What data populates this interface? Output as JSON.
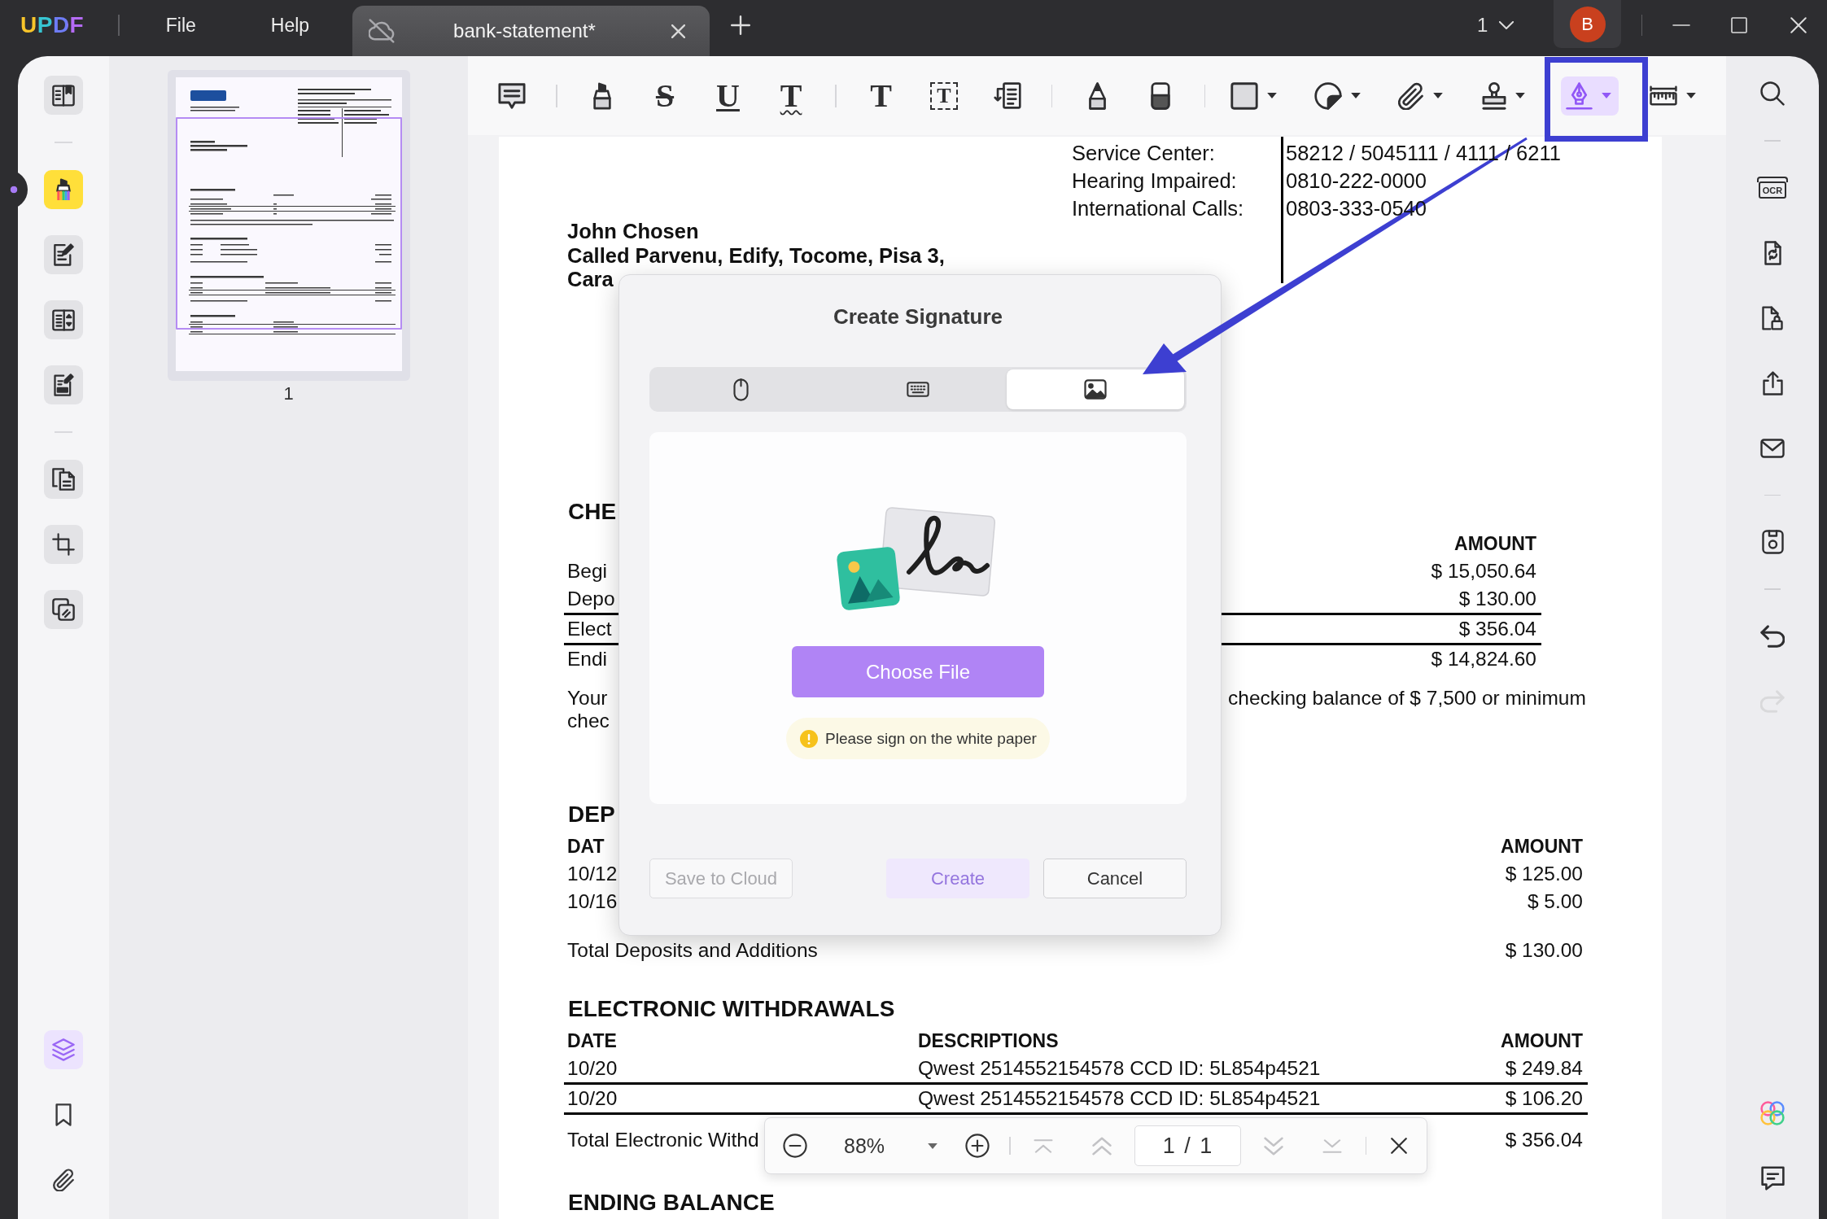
{
  "title_bar": {
    "logo": "UPDF",
    "menus": [
      "File",
      "Help"
    ],
    "tabs": [
      {
        "title": "bank-statement*",
        "selected": true
      }
    ],
    "window_count": "1",
    "avatar": "B"
  },
  "left_rail": {
    "groups": [
      [
        {
          "kind": "book",
          "selected": false
        }
      ],
      [
        {
          "kind": "highlighter",
          "selected": true
        },
        {
          "kind": "page-pen",
          "selected": false
        },
        {
          "kind": "page-list",
          "selected": false
        },
        {
          "kind": "page-sign",
          "selected": false
        }
      ],
      [
        {
          "kind": "pages",
          "selected": false
        },
        {
          "kind": "crop",
          "selected": false
        },
        {
          "kind": "overlap",
          "selected": false
        }
      ]
    ],
    "panels": [
      {
        "kind": "layers",
        "selected": true
      },
      {
        "kind": "bookmark",
        "selected": false
      },
      {
        "kind": "paperclip",
        "selected": false
      }
    ]
  },
  "thumbnails": [
    {
      "label": "1",
      "selected": true
    }
  ],
  "toolbar": {
    "groups": [
      [
        {
          "kind": "note",
          "menu": false,
          "selected": false
        }
      ],
      [
        {
          "kind": "highlight",
          "menu": false,
          "selected": false
        },
        {
          "kind": "strikethrough",
          "glyph": "S",
          "menu": false,
          "selected": false
        },
        {
          "kind": "underline",
          "glyph": "U",
          "menu": false,
          "selected": false
        },
        {
          "kind": "squiggly",
          "glyph": "T",
          "menu": false,
          "selected": false
        }
      ],
      [
        {
          "kind": "text",
          "glyph": "T",
          "menu": false,
          "selected": false
        },
        {
          "kind": "textbox",
          "glyph": "T",
          "menu": false,
          "selected": false
        },
        {
          "kind": "callout",
          "menu": false,
          "selected": false
        }
      ],
      [
        {
          "kind": "pencil",
          "menu": false,
          "selected": false
        },
        {
          "kind": "eraser",
          "menu": false,
          "selected": false
        }
      ],
      [
        {
          "kind": "shape",
          "menu": true,
          "selected": false
        },
        {
          "kind": "sticker",
          "menu": true,
          "selected": false
        },
        {
          "kind": "attachment",
          "menu": true,
          "selected": false
        },
        {
          "kind": "stamp",
          "menu": true,
          "selected": false
        },
        {
          "kind": "signature",
          "menu": true,
          "selected": true
        },
        {
          "kind": "measure",
          "menu": true,
          "selected": false
        }
      ]
    ]
  },
  "document": {
    "contact": [
      {
        "label": "Service Center:",
        "value": "58212 / 5045111 / 4111 / 6211"
      },
      {
        "label": "Hearing Impaired:",
        "value": "0810-222-0000"
      },
      {
        "label": "International Calls:",
        "value": "0803-333-0540"
      }
    ],
    "address": [
      "John Chosen",
      "Called Parvenu, Edify, Tocome, Pisa 3,",
      "Cara"
    ],
    "sections": [
      {
        "kind": "summary",
        "title": "CHE",
        "header": {
          "amount": "AMOUNT"
        },
        "rows": [
          {
            "label": "Begi",
            "amount": "$ 15,050.64",
            "rule_below": false
          },
          {
            "label": "Depo",
            "amount": "$ 130.00",
            "rule_below": true
          },
          {
            "label": "Elect",
            "amount": "$ 356.04",
            "rule_below": true
          },
          {
            "label": "Endi",
            "amount": "$ 14,824.60",
            "rule_below": false
          }
        ],
        "note": [
          {
            "left": "Your",
            "right": "checking balance of $ 7,500 or minimum"
          },
          {
            "left": "chec"
          }
        ]
      },
      {
        "kind": "deposits",
        "title": "DEP",
        "header": {
          "date": "DAT",
          "amount": "AMOUNT"
        },
        "rows": [
          {
            "date": "10/12",
            "amount": "$ 125.00",
            "rule_below": false
          },
          {
            "date": "10/16",
            "amount": "$ 5.00",
            "rule_below": false
          }
        ],
        "total": {
          "label": "Total Deposits and Additions",
          "amount": "$ 130.00"
        }
      },
      {
        "kind": "withdrawals",
        "title": "ELECTRONIC WITHDRAWALS",
        "header": {
          "date": "DATE",
          "description": "DESCRIPTIONS",
          "amount": "AMOUNT"
        },
        "rows": [
          {
            "date": "10/20",
            "description": "Qwest 2514552154578 CCD ID: 5L854p4521",
            "amount": "$ 249.84",
            "rule_below": true
          },
          {
            "date": "10/20",
            "description": "Qwest 2514552154578 CCD ID: 5L854p4521",
            "amount": "$ 106.20",
            "rule_below": true
          }
        ],
        "total": {
          "label": "Total Electronic Withd",
          "amount": "$ 356.04"
        }
      },
      {
        "kind": "ending",
        "title": "ENDING BALANCE"
      }
    ]
  },
  "dialog": {
    "title": "Create Signature",
    "tabs": [
      {
        "kind": "mouse",
        "selected": false
      },
      {
        "kind": "keyboard",
        "selected": false
      },
      {
        "kind": "image",
        "selected": true
      }
    ],
    "choose_button": "Choose File",
    "notice": "Please sign on the white paper",
    "buttons": [
      {
        "label": "Save to Cloud",
        "kind": "outline",
        "disabled": true
      },
      {
        "label": "Create",
        "kind": "primary",
        "disabled": true
      },
      {
        "label": "Cancel",
        "kind": "outline",
        "disabled": false
      }
    ]
  },
  "zoom_bar": {
    "zoom_level": "88%",
    "page_field": "1 / 1",
    "nav": [
      {
        "kind": "first",
        "disabled": true
      },
      {
        "kind": "previous",
        "disabled": true
      },
      {
        "kind": "next",
        "disabled": true
      },
      {
        "kind": "last",
        "disabled": true
      }
    ]
  },
  "right_rail": {
    "groups": [
      [
        {
          "kind": "search",
          "disabled": false
        }
      ],
      [
        {
          "kind": "ocr",
          "glyph": "OCR",
          "disabled": false
        },
        {
          "kind": "convert",
          "disabled": false
        },
        {
          "kind": "protect",
          "disabled": false
        },
        {
          "kind": "share",
          "disabled": false
        },
        {
          "kind": "mail",
          "disabled": false
        }
      ],
      [
        {
          "kind": "save",
          "disabled": false
        }
      ],
      [
        {
          "kind": "undo",
          "disabled": false
        },
        {
          "kind": "redo",
          "disabled": true
        }
      ]
    ],
    "bottom": [
      {
        "kind": "ai",
        "disabled": false
      },
      {
        "kind": "comment",
        "disabled": false
      }
    ]
  }
}
